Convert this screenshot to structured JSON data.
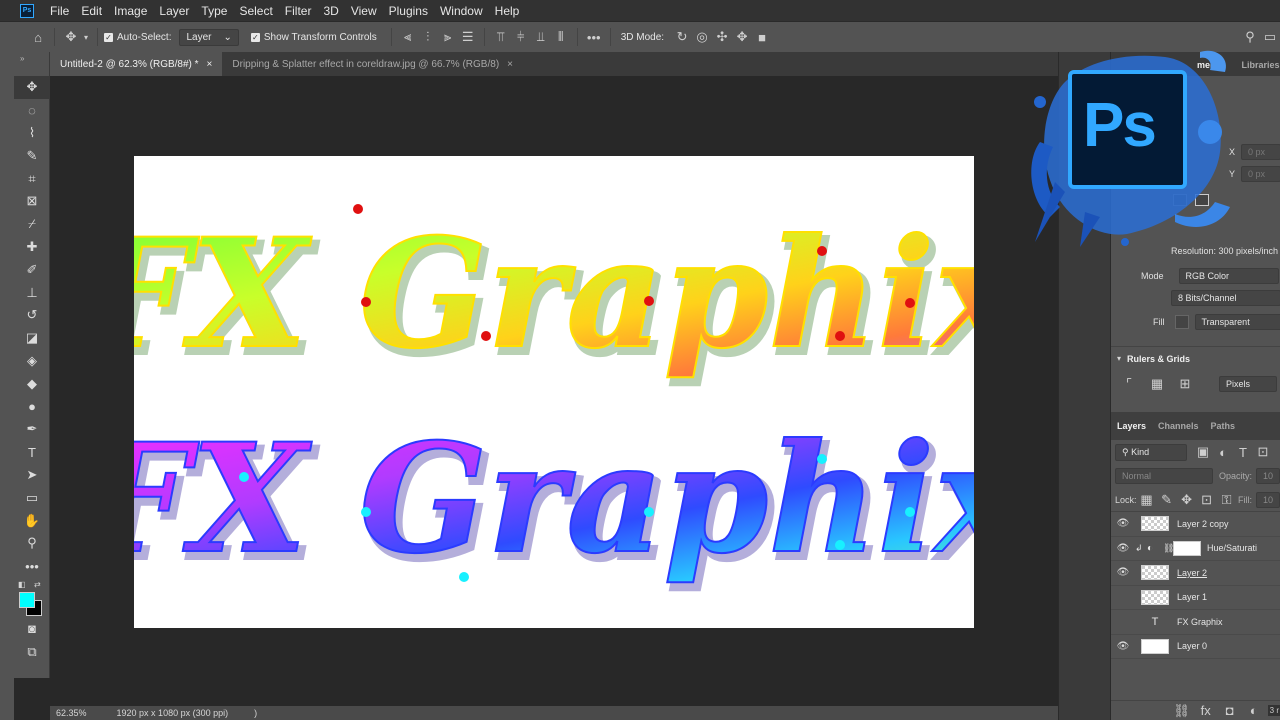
{
  "app": {
    "badge": "Ps"
  },
  "menu": [
    "File",
    "Edit",
    "Image",
    "Layer",
    "Type",
    "Select",
    "Filter",
    "3D",
    "View",
    "Plugins",
    "Window",
    "Help"
  ],
  "options": {
    "auto_select_label": "Auto-Select:",
    "auto_select_value": "Layer",
    "transform_label": "Show Transform Controls",
    "three_d_mode": "3D Mode:"
  },
  "tabs": [
    {
      "label": "Untitled-2 @ 62.3% (RGB/8#) *",
      "close": "×"
    },
    {
      "label": "Dripping & Splatter effect in coreldraw.jpg @ 66.7% (RGB/8)",
      "close": "×"
    }
  ],
  "canvas": {
    "line1_text": "FX Graphix",
    "line2_text": "FX Graphix"
  },
  "status": {
    "zoom": "62.35%",
    "doc_info": "1920 px x 1080 px (300 ppi)",
    "arrow": ")"
  },
  "properties": {
    "tab_partial": "ments",
    "libraries": "Libraries",
    "x_label": "X",
    "x_value": "0 px",
    "y_label": "Y",
    "y_value": "0 px",
    "resolution": "Resolution: 300 pixels/inch",
    "mode_label": "Mode",
    "mode_value": "RGB Color",
    "bits_value": "8 Bits/Channel",
    "fill_label": "Fill",
    "fill_value": "Transparent",
    "rulers_title": "Rulers & Grids",
    "units_value": "Pixels"
  },
  "layers_panel": {
    "tabs": [
      "Layers",
      "Channels",
      "Paths"
    ],
    "kind": "Kind",
    "blend": "Normal",
    "opacity_label": "Opacity:",
    "opacity_value": "10",
    "lock_label": "Lock:",
    "fill_label": "Fill:",
    "fill_value": "10",
    "layers": [
      {
        "name": "Layer 2 copy",
        "visible": true
      },
      {
        "name": "Hue/Saturati",
        "visible": true
      },
      {
        "name": "Layer 2",
        "visible": true
      },
      {
        "name": "Layer 1",
        "visible": false
      },
      {
        "name": "FX Graphix",
        "visible": false
      },
      {
        "name": "Layer 0",
        "visible": true
      }
    ],
    "bottom_hint": "3 r"
  },
  "logo": {
    "text": "Ps"
  },
  "colors": {
    "accent_blue": "#31a8ff",
    "foreground_swatch": "#00ffff",
    "background_swatch": "#000000"
  }
}
